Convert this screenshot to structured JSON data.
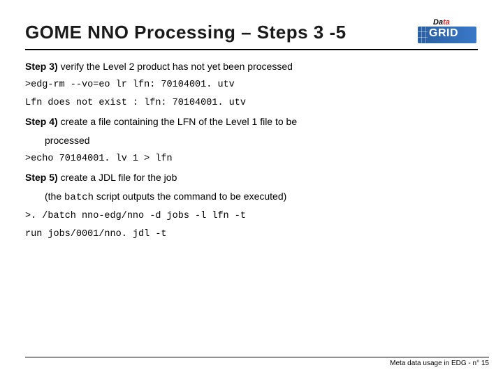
{
  "title": "GOME NNO Processing – Steps 3 -5",
  "logo": {
    "data_label_prefix": "Da",
    "data_label_suffix": "ta",
    "grid_label": "GRID"
  },
  "steps": {
    "s3": {
      "label": "Step 3)",
      "text": " verify the Level 2 product has not yet been processed",
      "cmd1": ">edg-rm --vo=eo lr lfn: 70104001. utv",
      "out1": "Lfn does not exist : lfn: 70104001. utv"
    },
    "s4": {
      "label": "Step 4)",
      "text": " create a file containing the LFN of the Level 1 file to be",
      "text_cont": "processed",
      "cmd1": ">echo 70104001. lv 1 > lfn"
    },
    "s5": {
      "label": "Step 5)",
      "text": " create a JDL file for the job",
      "sub_pre": "(the ",
      "sub_mono": "batch",
      "sub_post": " script outputs the command to be executed)",
      "cmd1": ">. /batch nno-edg/nno -d jobs -l lfn -t",
      "out1": "run jobs/0001/nno. jdl -t"
    }
  },
  "footer": "Meta data usage in EDG - n° 15"
}
